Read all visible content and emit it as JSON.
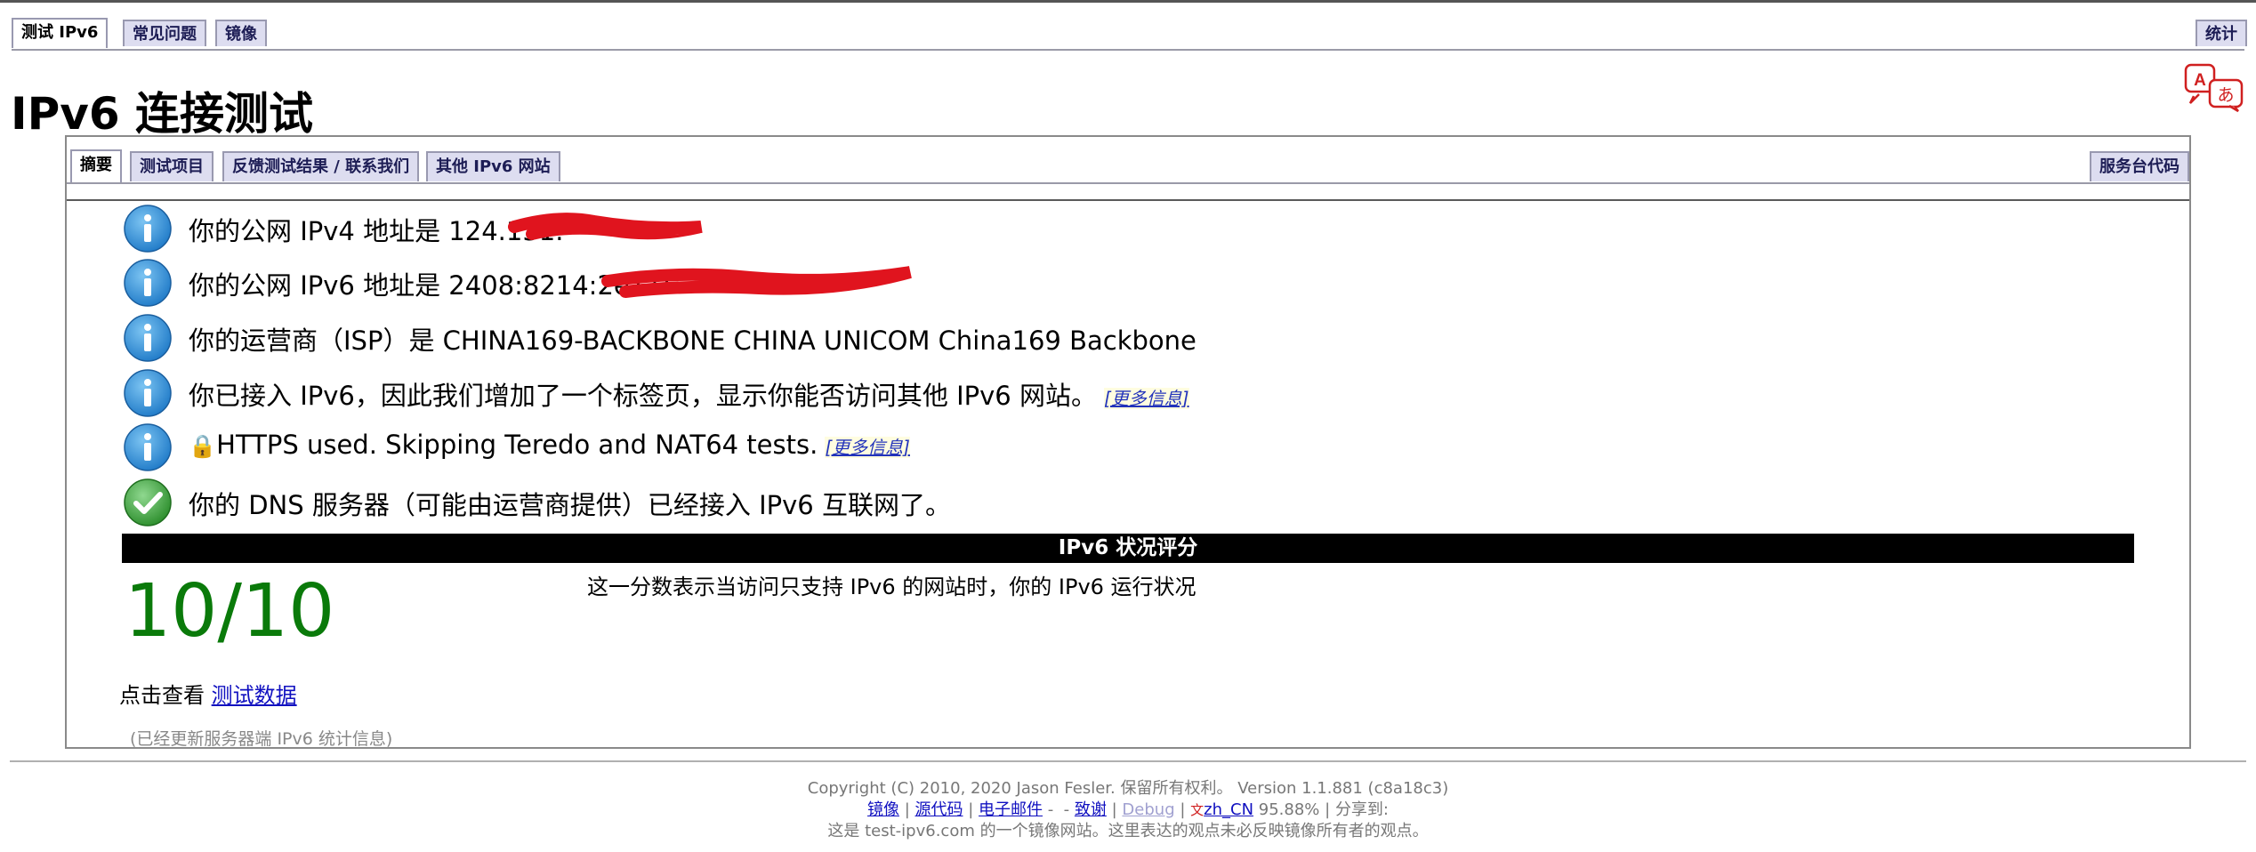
{
  "top_tabs": {
    "test_ipv6": "测试 IPv6",
    "faq": "常见问题",
    "mirrors": "镜像",
    "stats": "统计"
  },
  "page_title": "IPv6 连接测试",
  "inner_tabs": {
    "summary": "摘要",
    "tests_run": "测试项目",
    "feedback": "反馈测试结果 / 联系我们",
    "other_sites": "其他 IPv6 网站",
    "help_desk_code": "服务台代码"
  },
  "results": [
    {
      "icon": "info-icon",
      "text": "你的公网 IPv4 地址是 124.131.",
      "redacted": true
    },
    {
      "icon": "info-icon",
      "text": "你的公网 IPv6 地址是 2408:8214:2e11:",
      "redacted": true
    },
    {
      "icon": "info-icon",
      "text": "你的运营商（ISP）是 CHINA169-BACKBONE CHINA UNICOM China169 Backbone"
    },
    {
      "icon": "info-icon",
      "text": "你已接入 IPv6，因此我们增加了一个标签页，显示你能否访问其他 IPv6 网站。",
      "more": "[更多信息]"
    },
    {
      "icon": "info-icon",
      "lock": "🔒",
      "text": "HTTPS used. Skipping Teredo and NAT64 tests.",
      "more": "[更多信息]"
    },
    {
      "icon": "checkmark-icon",
      "text": "你的 DNS 服务器（可能由运营商提供）已经接入 IPv6 互联网了。"
    }
  ],
  "score": {
    "header": "IPv6 状况评分",
    "value": "10/10",
    "description": "这一分数表示当访问只支持 IPv6 的网站时，你的 IPv6 运行状况"
  },
  "details": {
    "prefix": "点击查看 ",
    "link": "测试数据"
  },
  "stats_note": "(已经更新服务器端 IPv6 统计信息)",
  "footer": {
    "copyright": "Copyright (C) 2010, 2020 Jason Fesler. 保留所有权利。 Version 1.1.881 (c8a18c3)",
    "links": {
      "mirrors": "镜像",
      "source": "源代码",
      "email": "电子邮件",
      "thanks": "致谢",
      "debug": "Debug",
      "locale": "zh_CN",
      "percent": "95.88%",
      "share": "分享到:"
    },
    "mirror_note": "这是 test-ipv6.com 的一个镜像网站。这里表达的观点未必反映镜像所有者的观点。"
  },
  "colors": {
    "tab_bg": "#ddddf0",
    "score_green": "#0a7a0a",
    "info_blue": "#2b8fd6",
    "check_green": "#2e9e2e",
    "scribble_red": "#e0141e"
  }
}
